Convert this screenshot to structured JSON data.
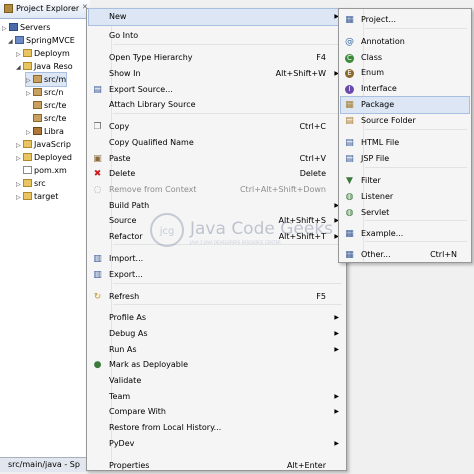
{
  "explorer": {
    "tab_title": "Project Explorer",
    "tab_close": "✕",
    "tree": [
      {
        "label": "Servers",
        "icon": "folder-icon",
        "twisty": "▷"
      },
      {
        "label": "SpringMVCE",
        "icon": "project-icon",
        "twisty": "◢"
      },
      {
        "label": "Deploym",
        "icon": "folder-icon",
        "twisty": "▷"
      },
      {
        "label": "Java Reso",
        "icon": "folder-icon",
        "twisty": "◢"
      },
      {
        "label": "src/m",
        "icon": "package-folder-icon",
        "twisty": "▷"
      },
      {
        "label": "src/n",
        "icon": "package-folder-icon",
        "twisty": "▷"
      },
      {
        "label": "src/te",
        "icon": "package-folder-icon",
        "twisty": ""
      },
      {
        "label": "src/te",
        "icon": "package-folder-icon",
        "twisty": ""
      },
      {
        "label": "Libra",
        "icon": "library-icon",
        "twisty": "▷"
      },
      {
        "label": "JavaScrip",
        "icon": "folder-icon",
        "twisty": "▷"
      },
      {
        "label": "Deployed",
        "icon": "folder-icon",
        "twisty": "▷"
      },
      {
        "label": "pom.xm",
        "icon": "file-icon",
        "twisty": ""
      },
      {
        "label": "src",
        "icon": "folder-icon",
        "twisty": "▷"
      },
      {
        "label": "target",
        "icon": "folder-icon",
        "twisty": "▷"
      }
    ]
  },
  "status_bar": {
    "text": "src/main/java - Sp"
  },
  "context_menu": {
    "items": [
      {
        "label": "New",
        "shortcut": "",
        "submenu": true
      },
      {
        "label": "Go Into",
        "shortcut": ""
      },
      {
        "label": "Open Type Hierarchy",
        "shortcut": "F4"
      },
      {
        "label": "Show In",
        "shortcut": "Alt+Shift+W",
        "submenu": true
      },
      {
        "label": "Export Source...",
        "shortcut": ""
      },
      {
        "label": "Attach Library Source",
        "shortcut": ""
      },
      {
        "label": "Copy",
        "shortcut": "Ctrl+C"
      },
      {
        "label": "Copy Qualified Name",
        "shortcut": ""
      },
      {
        "label": "Paste",
        "shortcut": "Ctrl+V"
      },
      {
        "label": "Delete",
        "shortcut": "Delete"
      },
      {
        "label": "Remove from Context",
        "shortcut": "Ctrl+Alt+Shift+Down"
      },
      {
        "label": "Build Path",
        "shortcut": "",
        "submenu": true
      },
      {
        "label": "Source",
        "shortcut": "Alt+Shift+S",
        "submenu": true
      },
      {
        "label": "Refactor",
        "shortcut": "Alt+Shift+T",
        "submenu": true
      },
      {
        "label": "Import...",
        "shortcut": ""
      },
      {
        "label": "Export...",
        "shortcut": ""
      },
      {
        "label": "Refresh",
        "shortcut": "F5"
      },
      {
        "label": "Profile As",
        "shortcut": "",
        "submenu": true
      },
      {
        "label": "Debug As",
        "shortcut": "",
        "submenu": true
      },
      {
        "label": "Run As",
        "shortcut": "",
        "submenu": true
      },
      {
        "label": "Mark as Deployable",
        "shortcut": ""
      },
      {
        "label": "Validate",
        "shortcut": ""
      },
      {
        "label": "Team",
        "shortcut": "",
        "submenu": true
      },
      {
        "label": "Compare With",
        "shortcut": "",
        "submenu": true
      },
      {
        "label": "Restore from Local History...",
        "shortcut": ""
      },
      {
        "label": "PyDev",
        "shortcut": "",
        "submenu": true
      },
      {
        "label": "Properties",
        "shortcut": "Alt+Enter"
      }
    ]
  },
  "submenu_new": {
    "items": [
      {
        "label": "Project...",
        "shortcut": ""
      },
      {
        "label": "Annotation",
        "shortcut": ""
      },
      {
        "label": "Class",
        "shortcut": ""
      },
      {
        "label": "Enum",
        "shortcut": ""
      },
      {
        "label": "Interface",
        "shortcut": ""
      },
      {
        "label": "Package",
        "shortcut": ""
      },
      {
        "label": "Source Folder",
        "shortcut": ""
      },
      {
        "label": "HTML File",
        "shortcut": ""
      },
      {
        "label": "JSP File",
        "shortcut": ""
      },
      {
        "label": "Filter",
        "shortcut": ""
      },
      {
        "label": "Listener",
        "shortcut": ""
      },
      {
        "label": "Servlet",
        "shortcut": ""
      },
      {
        "label": "Example...",
        "shortcut": ""
      },
      {
        "label": "Other...",
        "shortcut": "Ctrl+N"
      }
    ]
  },
  "watermark": {
    "logo_text": "jcg",
    "title": "Java Code Geeks",
    "tagline": "JAVA 2 JAVA DEVELOPERS RESOURCE CENTER"
  },
  "colors": {
    "selection": "#dce6f4",
    "menu_bg": "#f5f5f5",
    "disabled_text": "#8d8d8d"
  }
}
